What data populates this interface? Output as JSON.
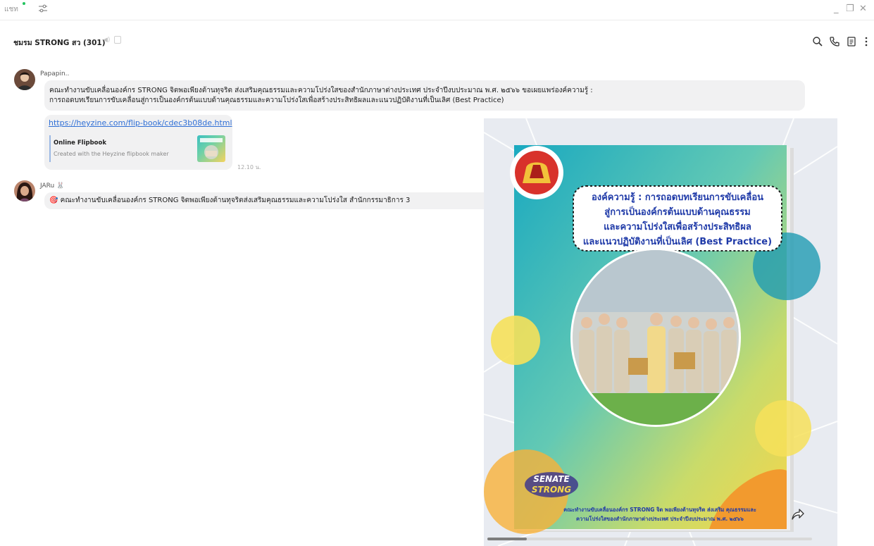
{
  "topbar": {
    "tab_label": "แชท",
    "filter_icon": "sliders-icon",
    "minimize": "_",
    "restore": "❐",
    "close": "✕"
  },
  "header": {
    "title": "ชมรม STRONG สว (301)",
    "icons": [
      "search-icon",
      "phone-icon",
      "notes-icon",
      "more-icon"
    ]
  },
  "messages": [
    {
      "sender": "Papapin..",
      "text_line1": "คณะทำงานขับเคลื่อนองค์กร STRONG จิตพอเพียงต้านทุจริต ส่งเสริมคุณธรรมและความโปร่งใสของสำนักภาษาต่างประเทศ ประจำปีงบประมาณ พ.ศ. ๒๕๖๖ ขอเผยแพร่องค์ความรู้ :",
      "text_line2": "การถอดบทเรียนการขับเคลื่อนสู่การเป็นองค์กรต้นแบบด้านคุณธรรมและความโปร่งใสเพื่อสร้างประสิทธิผลและแนวปฏิบัติงานที่เป็นเลิศ (Best Practice)"
    },
    {
      "link": "https://heyzine.com/flip-book/cdec3b08de.html",
      "preview_title": "Online Flipbook",
      "preview_desc": "Created with the Heyzine flipbook maker",
      "time": "12.10 น."
    },
    {
      "sender": "JARu 🐰",
      "text": "🎯 คณะทำงานขับเคลื่อนองค์กร STRONG จิตพอเพียงต้านทุจริตส่งเสริมคุณธรรมและความโปร่งใส สำนักกรรมาธิการ 3"
    }
  ],
  "image": {
    "title_line1": "องค์ความรู้ : การถอดบทเรียนการขับเคลื่อน",
    "title_line2": "สู่การเป็นองค์กรต้นแบบด้านคุณธรรม",
    "title_line3": "และความโปร่งใสเพื่อสร้างประสิทธิผล",
    "title_line4": "และแนวปฏิบัติงานที่เป็นเลิศ (Best Practice)",
    "logo_text_1": "SENATE",
    "logo_text_2": "STRONG",
    "footer_line1": "คณะทำงานขับเคลื่อนองค์กร STRONG จิต พอเพียงต้านทุจริต ส่งเสริม คุณธรรมและ",
    "footer_line2": "ความโปร่งใสของสำนักภาษาต่างประเทศ ประจำปีงบประมาณ พ.ศ. ๒๕๖๖",
    "share_icon": "share-arrow-icon"
  },
  "colors": {
    "link": "#2f6fd6",
    "bubble": "#f1f1f2",
    "cover_teal": "#2ab3c4",
    "cover_yellow": "#f6d64a",
    "cover_orange": "#f29a2e",
    "title_blue": "#1f3aa8"
  }
}
